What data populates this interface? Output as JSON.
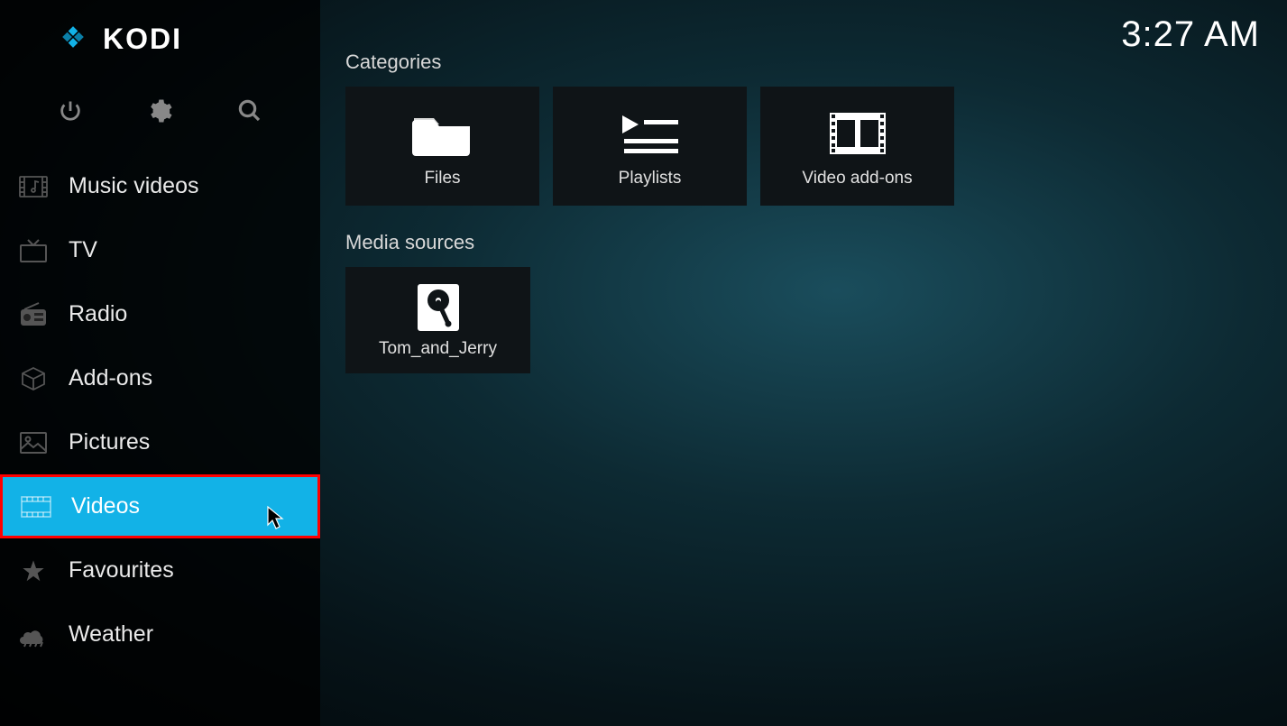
{
  "app_name": "KODI",
  "clock": "3:27 AM",
  "toolbar": {
    "power": "Power",
    "settings": "Settings",
    "search": "Search"
  },
  "nav": [
    {
      "id": "music-videos",
      "label": "Music videos",
      "icon": "music-video",
      "selected": false
    },
    {
      "id": "tv",
      "label": "TV",
      "icon": "tv",
      "selected": false
    },
    {
      "id": "radio",
      "label": "Radio",
      "icon": "radio",
      "selected": false
    },
    {
      "id": "addons",
      "label": "Add-ons",
      "icon": "box",
      "selected": false
    },
    {
      "id": "pictures",
      "label": "Pictures",
      "icon": "picture",
      "selected": false
    },
    {
      "id": "videos",
      "label": "Videos",
      "icon": "film",
      "selected": true
    },
    {
      "id": "favourites",
      "label": "Favourites",
      "icon": "star",
      "selected": false
    },
    {
      "id": "weather",
      "label": "Weather",
      "icon": "cloud",
      "selected": false
    }
  ],
  "sections": {
    "categories": {
      "label": "Categories",
      "items": [
        {
          "label": "Files",
          "icon": "folder"
        },
        {
          "label": "Playlists",
          "icon": "playlist"
        },
        {
          "label": "Video add-ons",
          "icon": "filmstrip"
        }
      ]
    },
    "media_sources": {
      "label": "Media sources",
      "items": [
        {
          "label": "Tom_and_Jerry",
          "icon": "harddrive"
        }
      ]
    }
  }
}
